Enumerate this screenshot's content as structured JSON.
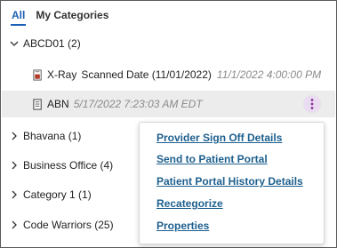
{
  "tabs": {
    "all": "All",
    "my_categories": "My Categories"
  },
  "groups": {
    "abcd01": "ABCD01 (2)",
    "bhavana": "Bhavana (1)",
    "business_office": "Business Office (4)",
    "category1": "Category 1 (1)",
    "code_warriors": "Code Warriors (25)"
  },
  "documents": [
    {
      "type": "X-Ray",
      "description": "Scanned Date (11/01/2022)",
      "timestamp": "11/1/2022 4:00:00 PM"
    },
    {
      "type": "ABN",
      "description": "",
      "timestamp": "5/17/2022 7:23:03 AM EDT"
    }
  ],
  "context_menu": {
    "items": [
      "Provider Sign Off Details",
      "Send to Patient Portal",
      "Patient Portal History Details",
      "Recategorize",
      "Properties"
    ]
  },
  "colors": {
    "link": "#1d5f8e",
    "kebab_bg": "#eadcf1",
    "kebab_dot": "#8a2c9e",
    "xray_icon": "#b23a2a"
  }
}
